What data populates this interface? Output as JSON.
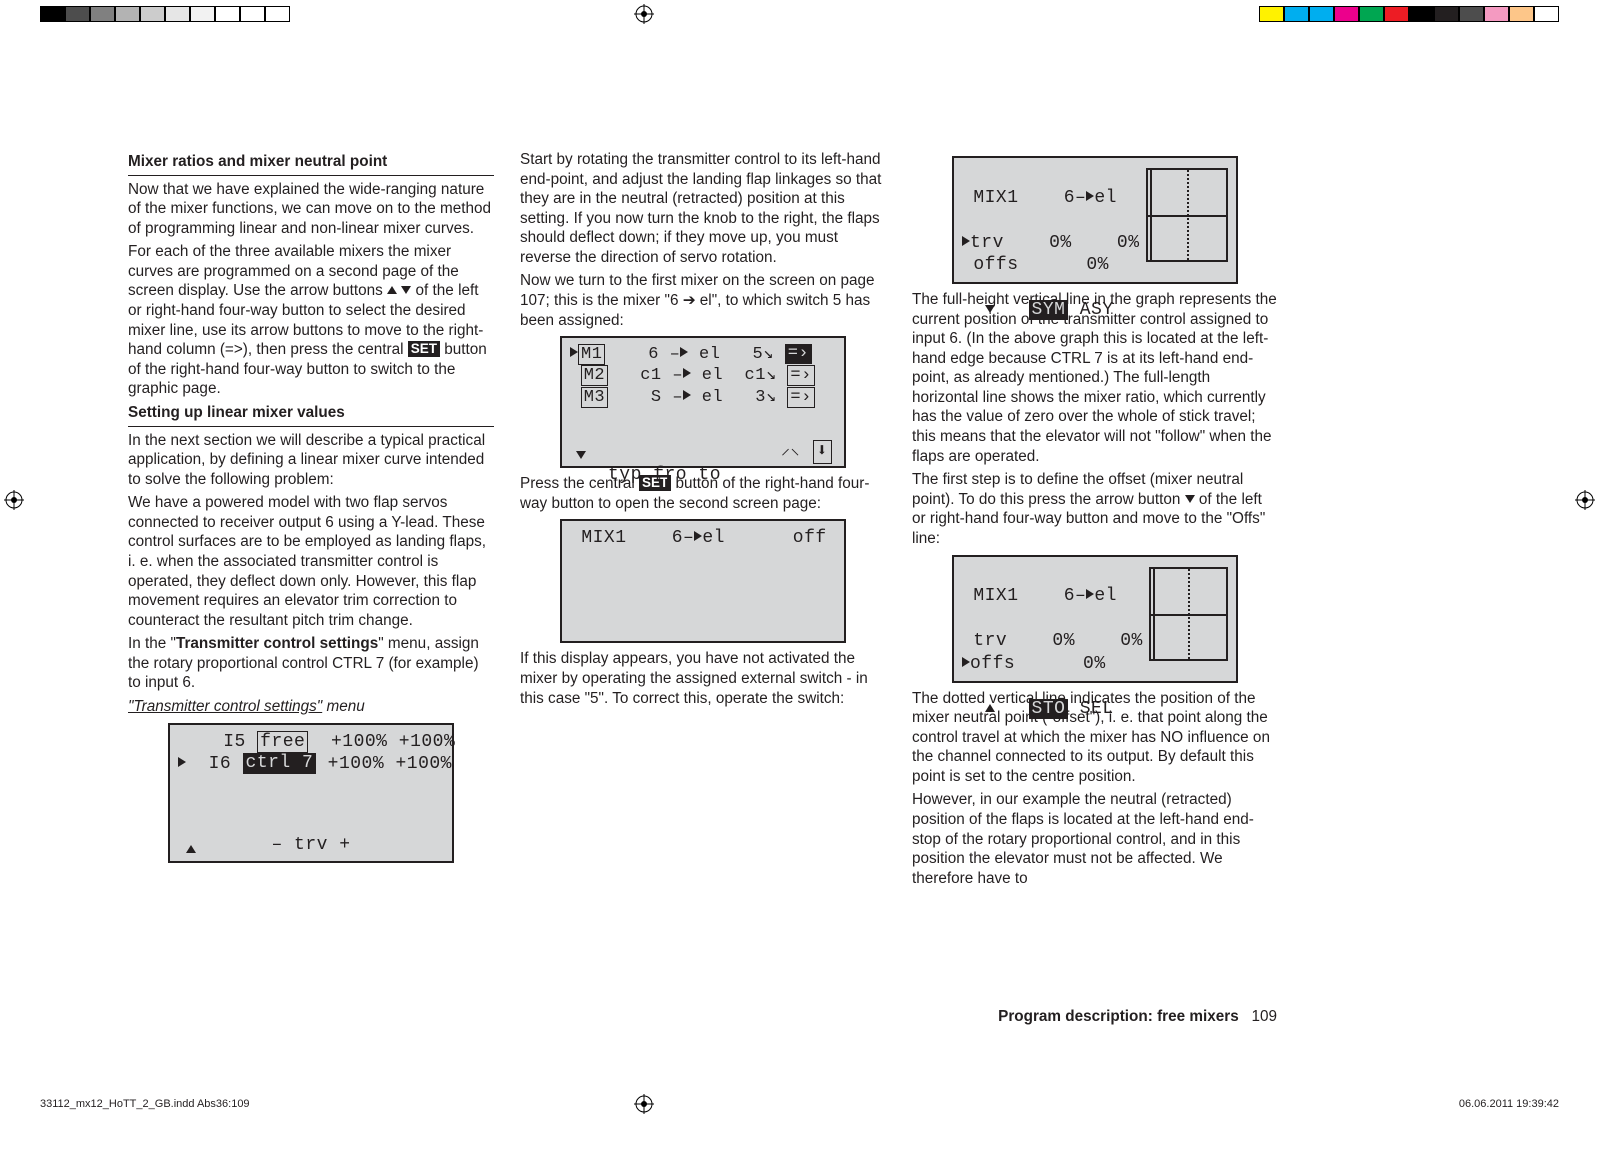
{
  "col1": {
    "head1": "Mixer ratios and mixer neutral point",
    "p1": "Now that we have explained the wide-ranging nature of the mixer functions, we can move on to the method of programming linear and non-linear mixer curves.",
    "p2a": "For each of the three available mixers the mixer curves are programmed on a second page of the screen display. Use the arrow buttons ",
    "p2b": " of the left or right-hand four-way button to select the desired mixer line, use its arrow buttons to move to the right-hand column (=>), then press the central ",
    "set": "SET",
    "p2c": " button of the right-hand four-way button to switch to the graphic page.",
    "head2": "Setting up linear mixer values",
    "p3": "In the next section we will describe a typical practical application, by defining a linear mixer curve intended to solve the following problem:",
    "p4": "We have a powered model with two flap servos connected to receiver output 6 using a Y-lead. These control surfaces are to be employed as landing flaps, i. e. when the associated transmitter control is operated, they deflect down only. However, this flap movement requires an elevator trim correction to counteract the resultant pitch trim change.",
    "p5a": "In the \"",
    "p5b": "Transmitter control settings",
    "p5c": "\" menu, assign the rotary proportional control CTRL 7 (for example) to input 6.",
    "p6a": "\"Transmitter control settings\"",
    "p6b": " menu",
    "screen1": {
      "l1a": "I5",
      "l1b": "free",
      "l1c": "+100% +100%",
      "l2a": "I6",
      "l2b": "ctrl 7",
      "l2c": "+100% +100%",
      "foot": "–  trv  +"
    }
  },
  "col2": {
    "p1": "Start by rotating the transmitter control to its left-hand end-point, and adjust the landing flap linkages so that they are in the neutral (retracted) position at this setting. If you now turn the knob to the right, the flaps should deflect down; if they move up, you must reverse the direction of servo rotation.",
    "p2a": "Now we turn to the first mixer on the screen on page 107; this is the mixer \"6 ",
    "p2b": " el\", to which switch 5 has been assigned:",
    "screen2": {
      "r1": {
        "m": "M1",
        "a": "6",
        "to": "el",
        "sw": "5",
        "sel": true
      },
      "r2": {
        "m": "M2",
        "a": "c1",
        "to": "el",
        "sw": "c1",
        "sel": false
      },
      "r3": {
        "m": "M3",
        "a": "S",
        "to": "el",
        "sw": "3",
        "sel": false
      },
      "foot": "typ  fro   to"
    },
    "p3a": "Press the central ",
    "p3b": " button of the right-hand four-way button to open the second screen page:",
    "screen3": {
      "title": "MIX1    6–",
      "el": "el",
      "off": "off"
    },
    "p4": "If this display appears, you have not activated the mixer by operating the assigned external switch - in this case \"5\". To correct this, operate the switch:"
  },
  "col3": {
    "screen4": {
      "title": "MIX1    6–",
      "el": "el",
      "trv": "trv    0%    0%",
      "offs": "offs      0%",
      "sym": "SYM",
      "asy": " ASY"
    },
    "p1": "The full-height vertical line in the graph represents the current position of the transmitter control assigned to input 6. (In the above graph this is located at the left-hand edge because CTRL 7 is at its left-hand end-point, as already mentioned.) The full-length horizontal line shows the mixer ratio, which currently has the value of zero over the whole of stick travel; this means that the elevator will not \"follow\" when the flaps are operated.",
    "p2a": "The first step is to define the offset (mixer neutral point). To do this press the arrow button ",
    "p2b": " of the left or right-hand four-way button and move to the \"Offs\" line:",
    "screen5": {
      "title": "MIX1    6–",
      "el": "el",
      "trv": " trv    0%    0%",
      "offs": "offs      0%",
      "sto": "STO",
      "sel": " SEL"
    },
    "p3": "The dotted vertical line indicates the position of the mixer neutral point (\"offset\"), i. e. that point along the control travel at which the mixer has NO influence on the channel connected to its output. By default this point is set to the centre position.",
    "p4": "However, in our example the neutral (retracted) position of the flaps is located at the left-hand end-stop of the rotary proportional control, and in this position the elevator must not be affected. We therefore have to"
  },
  "footer": {
    "title_b": "Program description: free mixers",
    "page": "109",
    "left": "33112_mx12_HoTT_2_GB.indd   Abs36:109",
    "right": "06.06.2011   19:39:42"
  },
  "colors": {
    "left": [
      "#ffffff",
      "#fff200",
      "#ec008c",
      "#2e3192",
      "#00aeef",
      "#00a651",
      "#000000",
      "#000000",
      "#4d4d4d",
      "#808080",
      "#b3b3b3",
      "#ffffff"
    ],
    "right": [
      "#fff200",
      "#00aeef",
      "#00aeef",
      "#ec008c",
      "#00a651",
      "#ed1c24",
      "#000000",
      "#231f20",
      "#4d4d4d",
      "#f49ac1",
      "#fdc689",
      "#ffffff"
    ]
  }
}
